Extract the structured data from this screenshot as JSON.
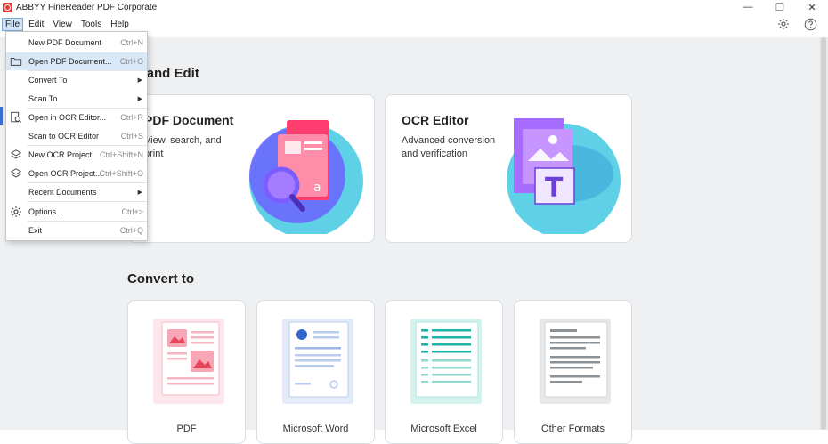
{
  "window": {
    "title": "ABBYY FineReader PDF Corporate",
    "controls": {
      "minimize": "—",
      "restore": "❐",
      "close": "✕"
    }
  },
  "menubar": {
    "items": [
      {
        "label": "File",
        "active": true
      },
      {
        "label": "Edit"
      },
      {
        "label": "View"
      },
      {
        "label": "Tools"
      },
      {
        "label": "Help"
      }
    ],
    "icons": [
      "gear-icon",
      "help-icon"
    ]
  },
  "file_menu": {
    "items": [
      {
        "label": "New PDF Document",
        "shortcut": "Ctrl+N",
        "icon": ""
      },
      {
        "label": "Open PDF Document...",
        "shortcut": "Ctrl+O",
        "icon": "folder-icon",
        "highlighted": true
      },
      {
        "label": "Convert To",
        "submenu": true
      },
      {
        "label": "Scan To",
        "submenu": true
      },
      {
        "label": "Open in OCR Editor...",
        "shortcut": "Ctrl+R",
        "icon": "ocr-search-icon"
      },
      {
        "label": "Scan to OCR Editor",
        "shortcut": "Ctrl+S"
      },
      {
        "label": "New OCR Project",
        "shortcut": "Ctrl+Shift+N",
        "icon": "layers-new-icon"
      },
      {
        "label": "Open OCR Project...",
        "shortcut": "Ctrl+Shift+O",
        "icon": "layers-open-icon"
      },
      {
        "label": "Recent Documents",
        "submenu": true
      },
      {
        "label": "Options...",
        "shortcut": "Ctrl+>",
        "icon": "gear-icon"
      },
      {
        "label": "Exit",
        "shortcut": "Ctrl+Q"
      }
    ]
  },
  "main": {
    "open_edit": {
      "title": "en and Edit",
      "cards": [
        {
          "title": "PDF Document",
          "desc": "View, search, and print"
        },
        {
          "title": "OCR Editor",
          "desc": "Advanced conversion and verification"
        }
      ]
    },
    "convert_to": {
      "title": "Convert to",
      "cards": [
        {
          "label": "PDF"
        },
        {
          "label": "Microsoft Word"
        },
        {
          "label": "Microsoft Excel"
        },
        {
          "label": "Other Formats"
        }
      ]
    }
  },
  "colors": {
    "accent": "#3b6fd3",
    "pdf_red": "#e8455a",
    "ocr_purple": "#8a3ff0",
    "word_blue": "#3366cc",
    "excel_teal": "#19b3a6",
    "background": "#eef0f2"
  }
}
